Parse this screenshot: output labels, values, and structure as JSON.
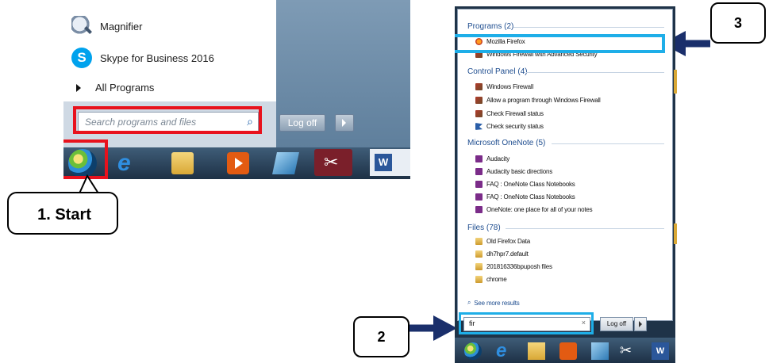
{
  "left_start_menu": {
    "items": [
      {
        "label": "Magnifier",
        "icon": "magnifier-icon"
      },
      {
        "label": "Skype for Business 2016",
        "icon": "skype-icon",
        "icon_glyph": "S"
      },
      {
        "label": "All Programs",
        "icon": "triangle-right-icon"
      }
    ],
    "search_placeholder": "Search programs and files",
    "log_off_label": "Log off"
  },
  "callouts": {
    "start": "1. Start",
    "search": "2",
    "result": "3"
  },
  "right_start_menu": {
    "groups": [
      {
        "title": "Programs (2)",
        "items": [
          "Mozilla Firefox",
          "Windows Firewall with Advanced Security"
        ]
      },
      {
        "title": "Control Panel (4)",
        "items": [
          "Windows Firewall",
          "Allow a program through Windows Firewall",
          "Check Firewall status",
          "Check security status"
        ]
      },
      {
        "title": "Microsoft OneNote (5)",
        "items": [
          "Audacity",
          "Audacity basic directions",
          "FAQ : OneNote Class Notebooks",
          "FAQ : OneNote Class Notebooks",
          "OneNote: one place for all of your notes"
        ]
      },
      {
        "title": "Files (78)",
        "items": [
          "Old Firefox Data",
          "dh7hpr7.default",
          "201816336bpuposh files",
          "chrome"
        ]
      }
    ],
    "see_more": "See more results",
    "search_value": "fir",
    "clear_glyph": "×",
    "log_off_label": "Log off"
  },
  "taskbar": {
    "word_glyph": "W",
    "snip_glyph": "✂",
    "ie_glyph": "e"
  },
  "colors": {
    "highlight_red": "#e8121d",
    "highlight_blue": "#1eaee8",
    "arrow_navy": "#1a2f6b"
  }
}
